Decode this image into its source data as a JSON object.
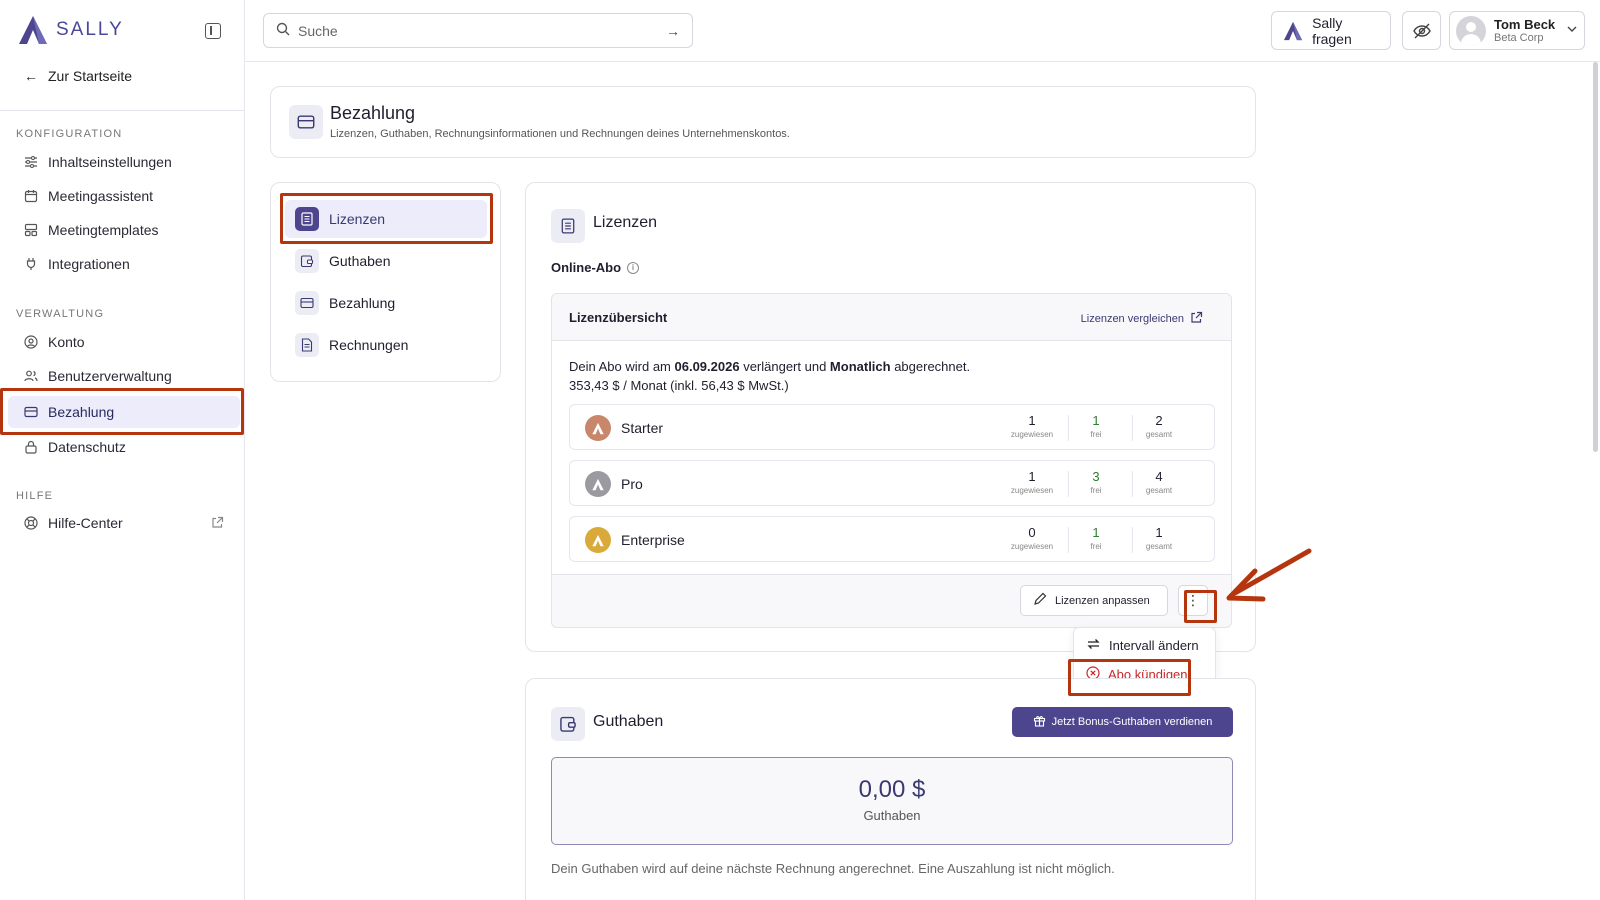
{
  "brand": {
    "name": "SALLY",
    "accent": "#4d468f",
    "highlight": "#b5350f"
  },
  "sidebar": {
    "back_label": "Zur Startseite",
    "sections": [
      {
        "title": "KONFIGURATION",
        "items": [
          "Inhaltseinstellungen",
          "Meetingassistent",
          "Meetingtemplates",
          "Integrationen"
        ]
      },
      {
        "title": "VERWALTUNG",
        "items": [
          "Konto",
          "Benutzerverwaltung",
          "Bezahlung",
          "Datenschutz"
        ]
      },
      {
        "title": "HILFE",
        "items": [
          "Hilfe-Center"
        ]
      }
    ],
    "active_item": "Bezahlung"
  },
  "topbar": {
    "search_placeholder": "Suche",
    "ask_label": "Sally fragen",
    "user": {
      "name": "Tom Beck",
      "org": "Beta Corp"
    }
  },
  "page": {
    "title": "Bezahlung",
    "subtitle": "Lizenzen, Guthaben, Rechnungsinformationen und Rechnungen deines Unternehmenskontos."
  },
  "subnav": {
    "items": [
      "Lizenzen",
      "Guthaben",
      "Bezahlung",
      "Rechnungen"
    ],
    "active": "Lizenzen"
  },
  "licenses": {
    "title": "Lizenzen",
    "plan_type": "Online-Abo",
    "overview_title": "Lizenzübersicht",
    "compare_label": "Lizenzen vergleichen",
    "info_prefix": "Dein Abo wird am ",
    "renew_date": "06.09.2026",
    "info_mid": " verlängert und ",
    "interval": "Monatlich",
    "info_suffix": " abgerechnet.",
    "price_line": "353,43 $ / Monat (inkl. 56,43 $ MwSt.)",
    "stat_labels": {
      "assigned": "zugewiesen",
      "free": "frei",
      "total": "gesamt"
    },
    "plans": [
      {
        "name": "Starter",
        "assigned": "1",
        "free": "1",
        "total": "2",
        "color": "#c8866a"
      },
      {
        "name": "Pro",
        "assigned": "1",
        "free": "3",
        "total": "4",
        "color": "#9a9aa0"
      },
      {
        "name": "Enterprise",
        "assigned": "0",
        "free": "1",
        "total": "1",
        "color": "#d9a93a"
      }
    ],
    "adjust_label": "Lizenzen anpassen",
    "menu": {
      "change_interval": "Intervall ändern",
      "cancel": "Abo kündigen"
    }
  },
  "credits": {
    "title": "Guthaben",
    "bonus_button": "Jetzt Bonus-Guthaben verdienen",
    "amount": "0,00 $",
    "amount_label": "Guthaben",
    "note": "Dein Guthaben wird auf deine nächste Rechnung angerechnet. Eine Auszahlung ist nicht möglich."
  }
}
